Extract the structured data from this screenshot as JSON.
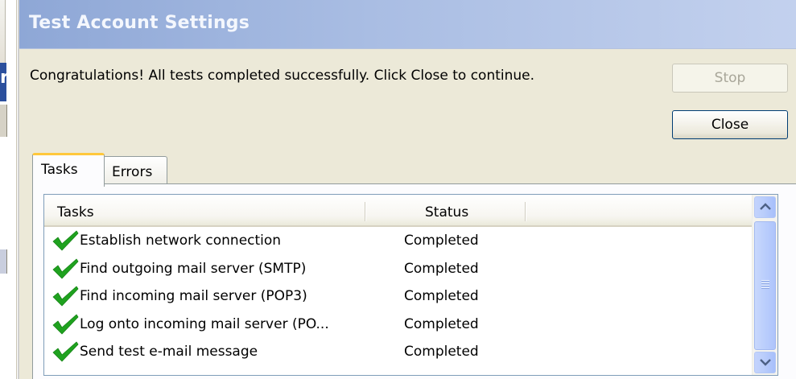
{
  "dialog": {
    "title": "Test Account Settings",
    "message": "Congratulations! All tests completed successfully. Click Close to continue."
  },
  "buttons": {
    "stop_label": "Stop",
    "close_label": "Close"
  },
  "tabs": [
    {
      "label": "Tasks",
      "selected": true
    },
    {
      "label": "Errors",
      "selected": false
    }
  ],
  "list": {
    "columns": [
      "Tasks",
      "Status"
    ],
    "rows": [
      {
        "task": "Establish network connection",
        "status": "Completed",
        "icon": "check-icon"
      },
      {
        "task": "Find outgoing mail server (SMTP)",
        "status": "Completed",
        "icon": "check-icon"
      },
      {
        "task": "Find incoming mail server (POP3)",
        "status": "Completed",
        "icon": "check-icon"
      },
      {
        "task": "Log onto incoming mail server (PO...",
        "status": "Completed",
        "icon": "check-icon"
      },
      {
        "task": "Send test e-mail message",
        "status": "Completed",
        "icon": "check-icon"
      }
    ]
  },
  "colors": {
    "titlebar": "#a9bde3",
    "dialog_bg": "#ece9d8",
    "check": "#1fa21f",
    "active_tab_accent": "#ffc83c"
  }
}
